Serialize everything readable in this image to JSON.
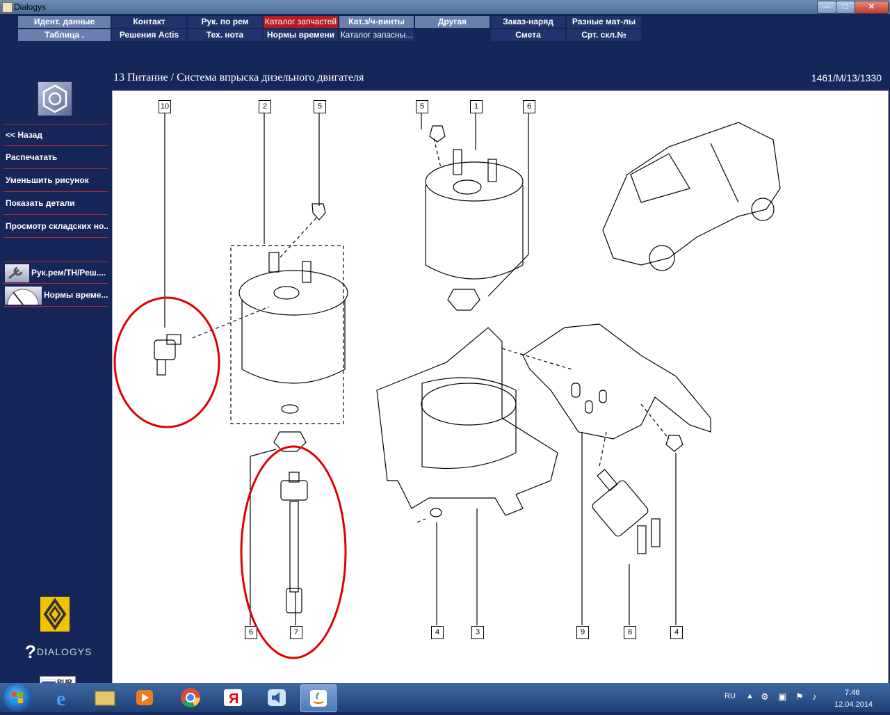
{
  "window": {
    "title": "Dialogys",
    "controls": {
      "minimize": "—",
      "maximize": "□",
      "close": "✕"
    }
  },
  "menu": {
    "row1": [
      {
        "label": "Идент. данные",
        "style": "gray"
      },
      {
        "label": "Контакт",
        "style": "dark"
      },
      {
        "label": "Рук. по рем",
        "style": "dark"
      },
      {
        "label": "Каталог запчастей",
        "style": "red"
      },
      {
        "label": "Кат.з/ч-винты",
        "style": "gray"
      },
      {
        "label": "Другая",
        "style": "gray"
      },
      {
        "label": "Заказ-наряд",
        "style": "dark"
      },
      {
        "label": "Разные мат-лы",
        "style": "dark"
      }
    ],
    "row2": [
      {
        "label": "Таблица .",
        "style": "gray"
      },
      {
        "label": "Решения Actis",
        "style": "dark"
      },
      {
        "label": "Тех. нота",
        "style": "dark"
      },
      {
        "label": "Нормы времени",
        "style": "dark"
      },
      {
        "label": "Каталог запасны...",
        "style": "dark"
      },
      {
        "label": "Смета",
        "style": "dark"
      },
      {
        "label": "Срт. скл.№",
        "style": "dark"
      }
    ]
  },
  "header": {
    "title": "13 Питание / Система впрыска дизельного двигателя",
    "code": "1461/M/13/1330"
  },
  "sidebar": {
    "items": [
      {
        "label": "<< Назад"
      },
      {
        "label": "Распечатать"
      },
      {
        "label": "Уменьшить рисунок"
      },
      {
        "label": "Показать детали"
      },
      {
        "label": "Просмотр складских но..."
      }
    ],
    "tools": [
      {
        "label": "Рук.рем/ТН/Реш....",
        "icon": "wrench-icon"
      },
      {
        "label": "Нормы време...",
        "icon": "clock-icon"
      }
    ],
    "brand": "DIALOGYS",
    "language": "RUR"
  },
  "diagram": {
    "callouts": [
      "10",
      "2",
      "5",
      "5",
      "1",
      "6",
      "6",
      "7",
      "4",
      "3",
      "9",
      "8",
      "4"
    ],
    "highlight_color": "#e00000"
  },
  "taskbar": {
    "apps": [
      "internet-explorer-icon",
      "file-explorer-icon",
      "media-player-icon",
      "chrome-icon",
      "yandex-icon",
      "volume-app-icon",
      "java-icon"
    ],
    "lang": "RU",
    "time": "7:46",
    "date": "12.04.2014"
  }
}
